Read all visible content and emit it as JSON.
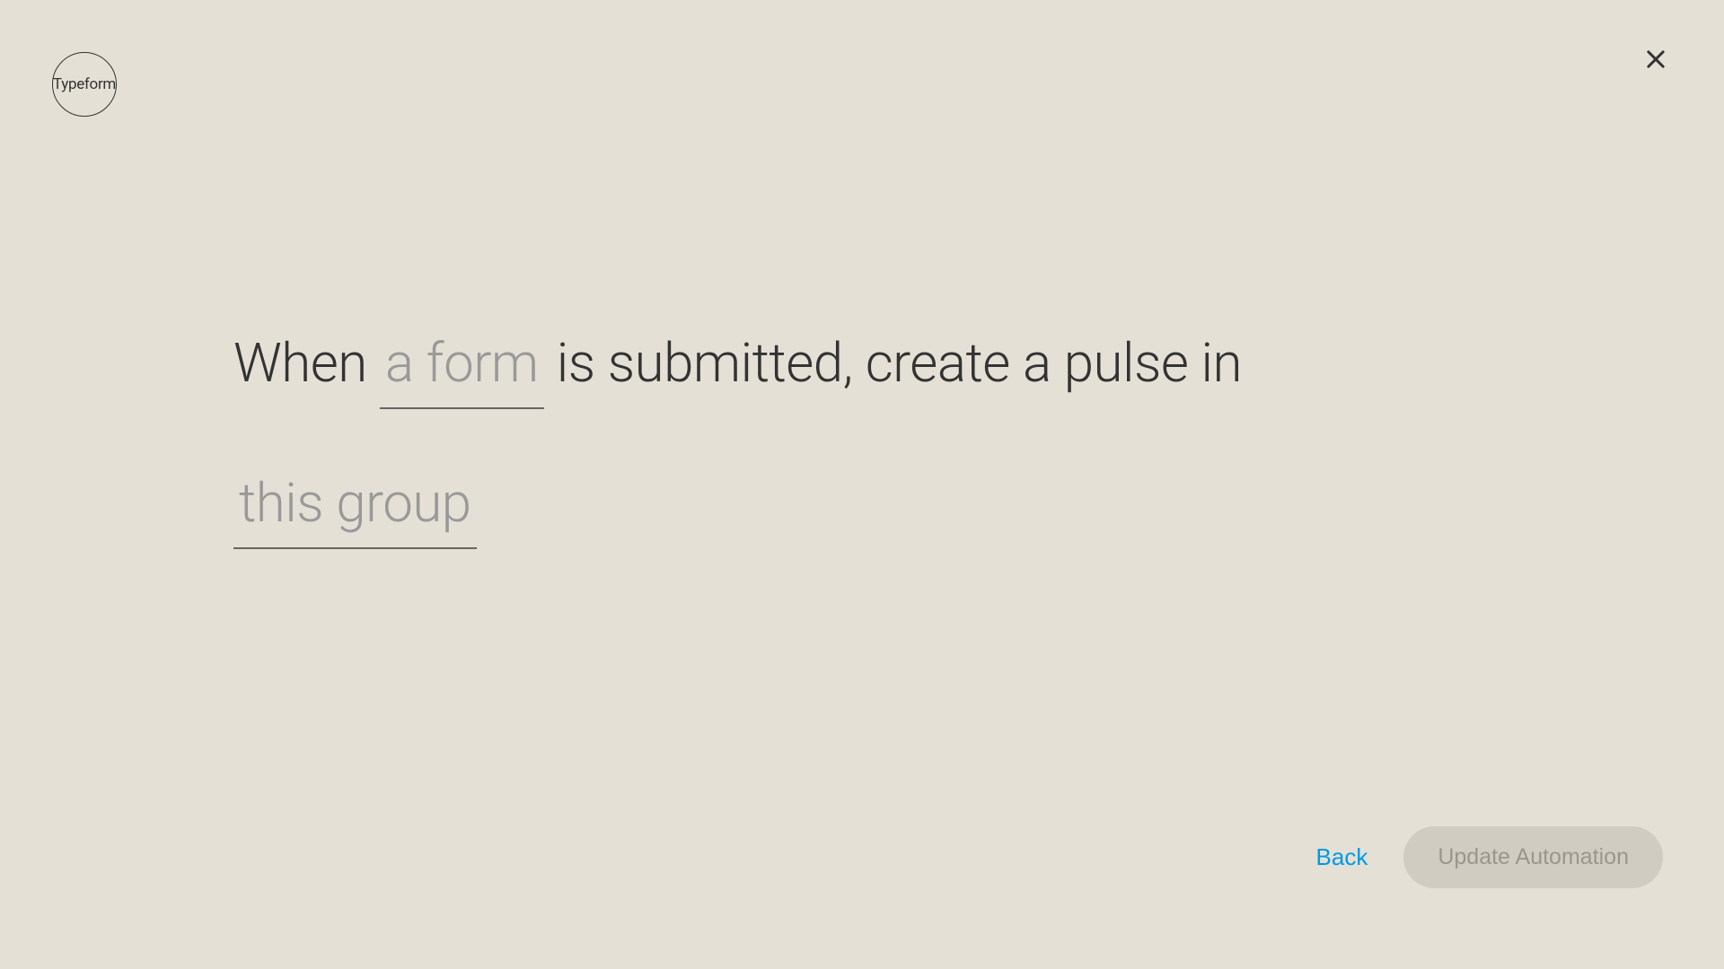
{
  "logo": {
    "text": "Typeform"
  },
  "sentence": {
    "prefix": "When",
    "form_placeholder": "a form",
    "middle": "is submitted, create a pulse in",
    "group_placeholder": "this group"
  },
  "footer": {
    "back_label": "Back",
    "update_label": "Update Automation"
  }
}
